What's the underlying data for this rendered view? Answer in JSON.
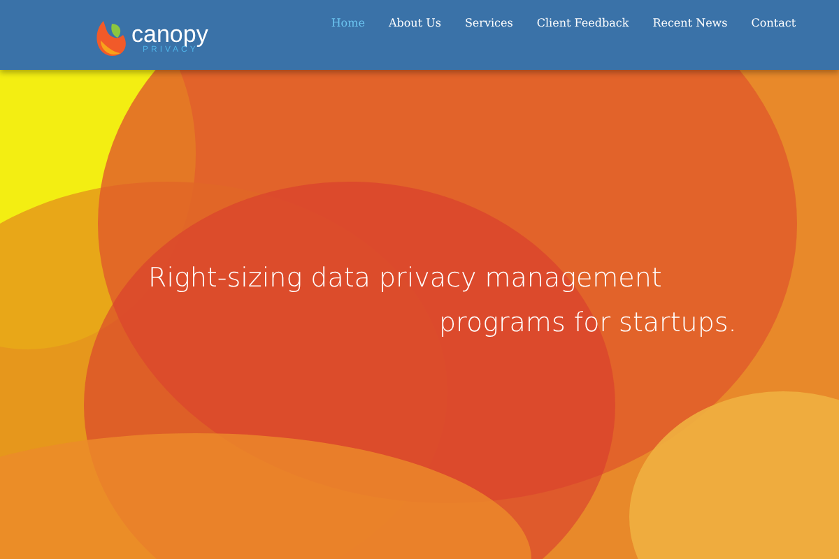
{
  "logo": {
    "name": "canopy",
    "tagline": "PRIVACY"
  },
  "nav": [
    {
      "label": "Home",
      "selected": true
    },
    {
      "label": "About Us",
      "selected": false
    },
    {
      "label": "Services",
      "selected": false
    },
    {
      "label": "Client Feedback",
      "selected": false
    },
    {
      "label": "Recent News",
      "selected": false
    },
    {
      "label": "Contact",
      "selected": false
    }
  ],
  "hero": {
    "lines": [
      "Right-sizing data privacy management",
      "programs for startups."
    ]
  }
}
